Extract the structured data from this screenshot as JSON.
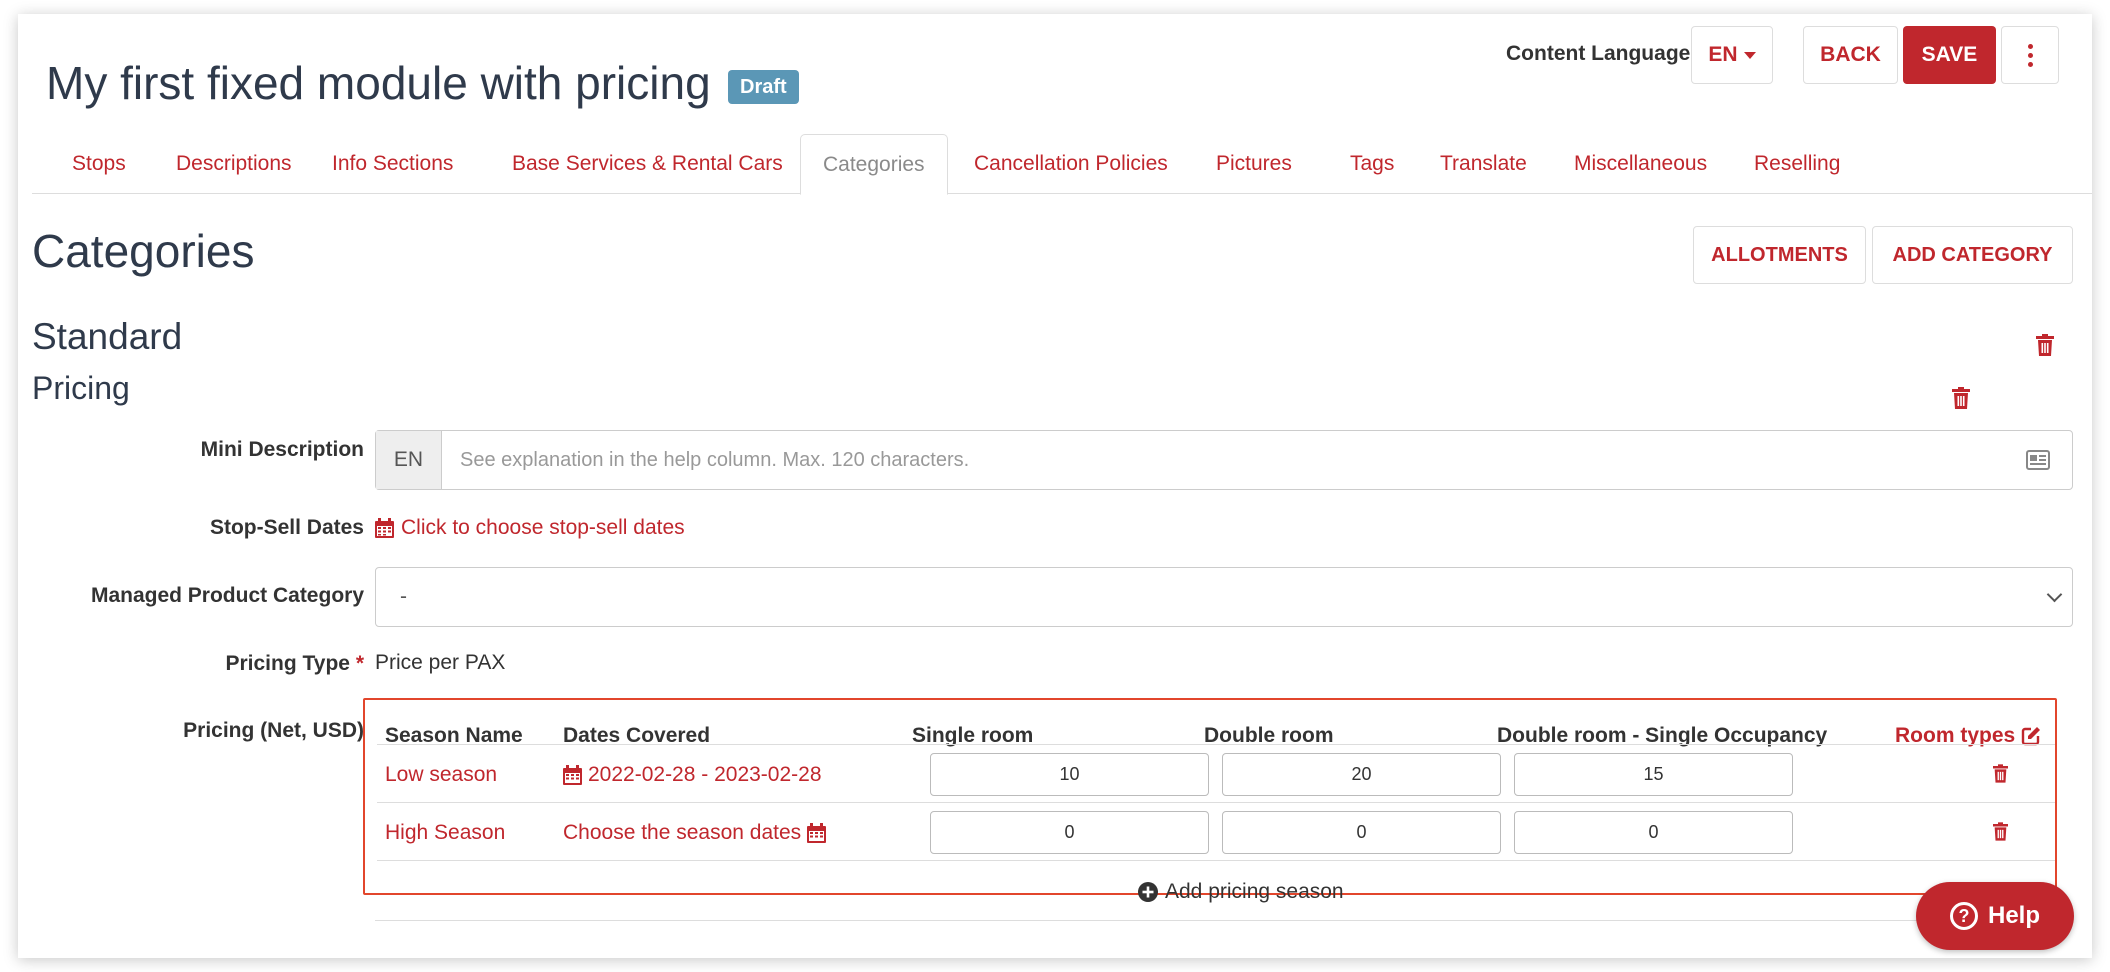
{
  "header": {
    "title": "My first fixed module with pricing",
    "status_badge": "Draft",
    "content_language_label": "Content Language",
    "language_value": "EN",
    "back_label": "BACK",
    "save_label": "SAVE"
  },
  "tabs": [
    {
      "label": "Stops"
    },
    {
      "label": "Descriptions"
    },
    {
      "label": "Info Sections"
    },
    {
      "label": "Base Services & Rental Cars"
    },
    {
      "label": "Categories",
      "active": true
    },
    {
      "label": "Cancellation Policies"
    },
    {
      "label": "Pictures"
    },
    {
      "label": "Tags"
    },
    {
      "label": "Translate"
    },
    {
      "label": "Miscellaneous"
    },
    {
      "label": "Reselling"
    }
  ],
  "categories_section": {
    "heading": "Categories",
    "allotments_label": "ALLOTMENTS",
    "add_category_label": "ADD CATEGORY"
  },
  "category": {
    "name": "Standard",
    "pricing_heading": "Pricing",
    "mini_description": {
      "label": "Mini Description",
      "lang": "EN",
      "placeholder": "See explanation in the help column. Max. 120 characters.",
      "value": ""
    },
    "stop_sell": {
      "label": "Stop-Sell Dates",
      "link": "Click to choose stop-sell dates"
    },
    "managed_product_category": {
      "label": "Managed Product Category",
      "selected": "-"
    },
    "pricing_type": {
      "label": "Pricing Type",
      "required_marker": "*",
      "value": "Price per PAX"
    },
    "pricing": {
      "label": "Pricing (Net, USD)",
      "columns": [
        "Season Name",
        "Dates Covered",
        "Single room",
        "Double room",
        "Double room - Single Occupancy",
        "Room types"
      ],
      "rows": [
        {
          "season": "Low season",
          "dates": "2022-02-28 - 2023-02-28",
          "single": "10",
          "double": "20",
          "double_single": "15"
        },
        {
          "season": "High Season",
          "dates": "Choose the season dates",
          "single": "0",
          "double": "0",
          "double_single": "0"
        }
      ],
      "add_season_label": "Add pricing season"
    }
  },
  "help_button": {
    "label": "Help"
  },
  "colors": {
    "accent": "#c0272d",
    "badge": "#5b97b6",
    "highlight_border": "#e2462c",
    "heading": "#2f3a4b"
  },
  "icons": [
    "calendar-icon",
    "trash-icon",
    "edit-icon",
    "plus-circle-icon",
    "id-card-icon",
    "kebab-menu-icon",
    "question-circle-icon",
    "caret-down-icon",
    "chevron-down-icon"
  ]
}
